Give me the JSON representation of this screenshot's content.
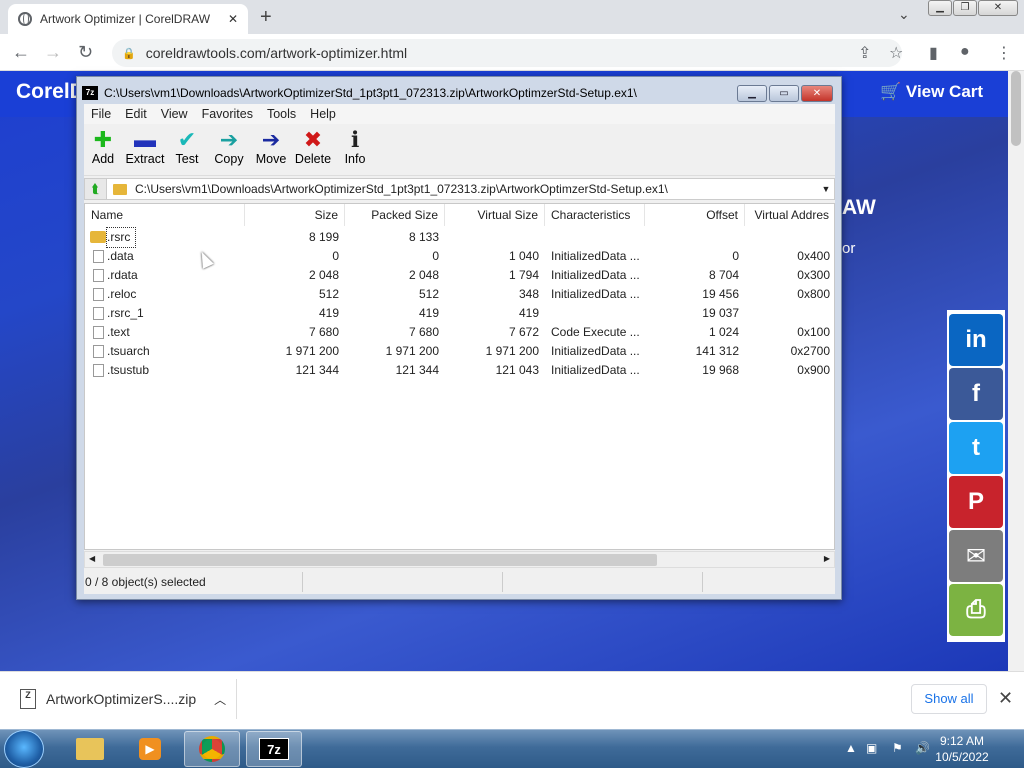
{
  "browser": {
    "tab_title": "Artwork Optimizer | CorelDRAW",
    "new_tab": "+",
    "url": "coreldrawtools.com/artwork-optimizer.html"
  },
  "webpage": {
    "logo_text": "CorelD",
    "view_cart": "View Cart",
    "heading_fragment": "AW",
    "sub_fragment": "or",
    "share_buttons": [
      {
        "name": "linkedin",
        "glyph": "in",
        "color": "#0a66c2"
      },
      {
        "name": "facebook",
        "glyph": "f",
        "color": "#3b5998"
      },
      {
        "name": "twitter",
        "glyph": "t",
        "color": "#1da1f2"
      },
      {
        "name": "pinterest",
        "glyph": "P",
        "color": "#c8232c"
      },
      {
        "name": "email",
        "glyph": "✉",
        "color": "#7d7d7d"
      },
      {
        "name": "print",
        "glyph": "⎙",
        "color": "#7cb342"
      }
    ]
  },
  "sevenzip": {
    "title": "C:\\Users\\vm1\\Downloads\\ArtworkOptimizerStd_1pt3pt1_072313.zip\\ArtworkOptimzerStd-Setup.ex1\\",
    "menu": [
      "File",
      "Edit",
      "View",
      "Favorites",
      "Tools",
      "Help"
    ],
    "tools": [
      {
        "label": "Add",
        "glyph": "✚",
        "color": "#1cb81c"
      },
      {
        "label": "Extract",
        "glyph": "▬",
        "color": "#2233bb"
      },
      {
        "label": "Test",
        "glyph": "✔",
        "color": "#1ab8b8"
      },
      {
        "label": "Copy",
        "glyph": "➔",
        "color": "#1aa0a0"
      },
      {
        "label": "Move",
        "glyph": "➔",
        "color": "#1a2aa0"
      },
      {
        "label": "Delete",
        "glyph": "✖",
        "color": "#d01818"
      },
      {
        "label": "Info",
        "glyph": "ℹ",
        "color": "#222"
      }
    ],
    "path": "C:\\Users\\vm1\\Downloads\\ArtworkOptimizerStd_1pt3pt1_072313.zip\\ArtworkOptimzerStd-Setup.ex1\\",
    "columns": [
      "Name",
      "Size",
      "Packed Size",
      "Virtual Size",
      "Characteristics",
      "Offset",
      "Virtual Addres"
    ],
    "rows": [
      {
        "name": ".rsrc",
        "type": "folder",
        "size": "8 199",
        "packed": "8 133",
        "vsize": "",
        "chars": "",
        "offset": "",
        "vaddr": ""
      },
      {
        "name": ".data",
        "type": "file",
        "size": "0",
        "packed": "0",
        "vsize": "1 040",
        "chars": "InitializedData ...",
        "offset": "0",
        "vaddr": "0x400"
      },
      {
        "name": ".rdata",
        "type": "file",
        "size": "2 048",
        "packed": "2 048",
        "vsize": "1 794",
        "chars": "InitializedData ...",
        "offset": "8 704",
        "vaddr": "0x300"
      },
      {
        "name": ".reloc",
        "type": "file",
        "size": "512",
        "packed": "512",
        "vsize": "348",
        "chars": "InitializedData ...",
        "offset": "19 456",
        "vaddr": "0x800"
      },
      {
        "name": ".rsrc_1",
        "type": "file",
        "size": "419",
        "packed": "419",
        "vsize": "419",
        "chars": "",
        "offset": "19 037",
        "vaddr": ""
      },
      {
        "name": ".text",
        "type": "file",
        "size": "7 680",
        "packed": "7 680",
        "vsize": "7 672",
        "chars": "Code Execute ...",
        "offset": "1 024",
        "vaddr": "0x100"
      },
      {
        "name": ".tsuarch",
        "type": "file",
        "size": "1 971 200",
        "packed": "1 971 200",
        "vsize": "1 971 200",
        "chars": "InitializedData ...",
        "offset": "141 312",
        "vaddr": "0x2700"
      },
      {
        "name": ".tsustub",
        "type": "file",
        "size": "121 344",
        "packed": "121 344",
        "vsize": "121 043",
        "chars": "InitializedData ...",
        "offset": "19 968",
        "vaddr": "0x900"
      }
    ],
    "status": "0 / 8 object(s) selected"
  },
  "downloads": {
    "file": "ArtworkOptimizerS....zip",
    "show_all": "Show all"
  },
  "taskbar": {
    "time": "9:12 AM",
    "date": "10/5/2022"
  }
}
